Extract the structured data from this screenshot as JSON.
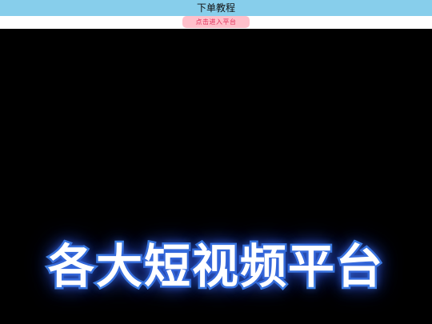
{
  "header": {
    "title": "下单教程",
    "background_color": "#87ceeb"
  },
  "actions": {
    "enter_platform_label": "点击进入平台",
    "button_color": "#ffc0cb",
    "button_text_color": "#e0305a"
  },
  "video": {
    "caption": "各大短视频平台",
    "background_color": "#000000",
    "caption_outline_color": "#4a9bf0"
  }
}
